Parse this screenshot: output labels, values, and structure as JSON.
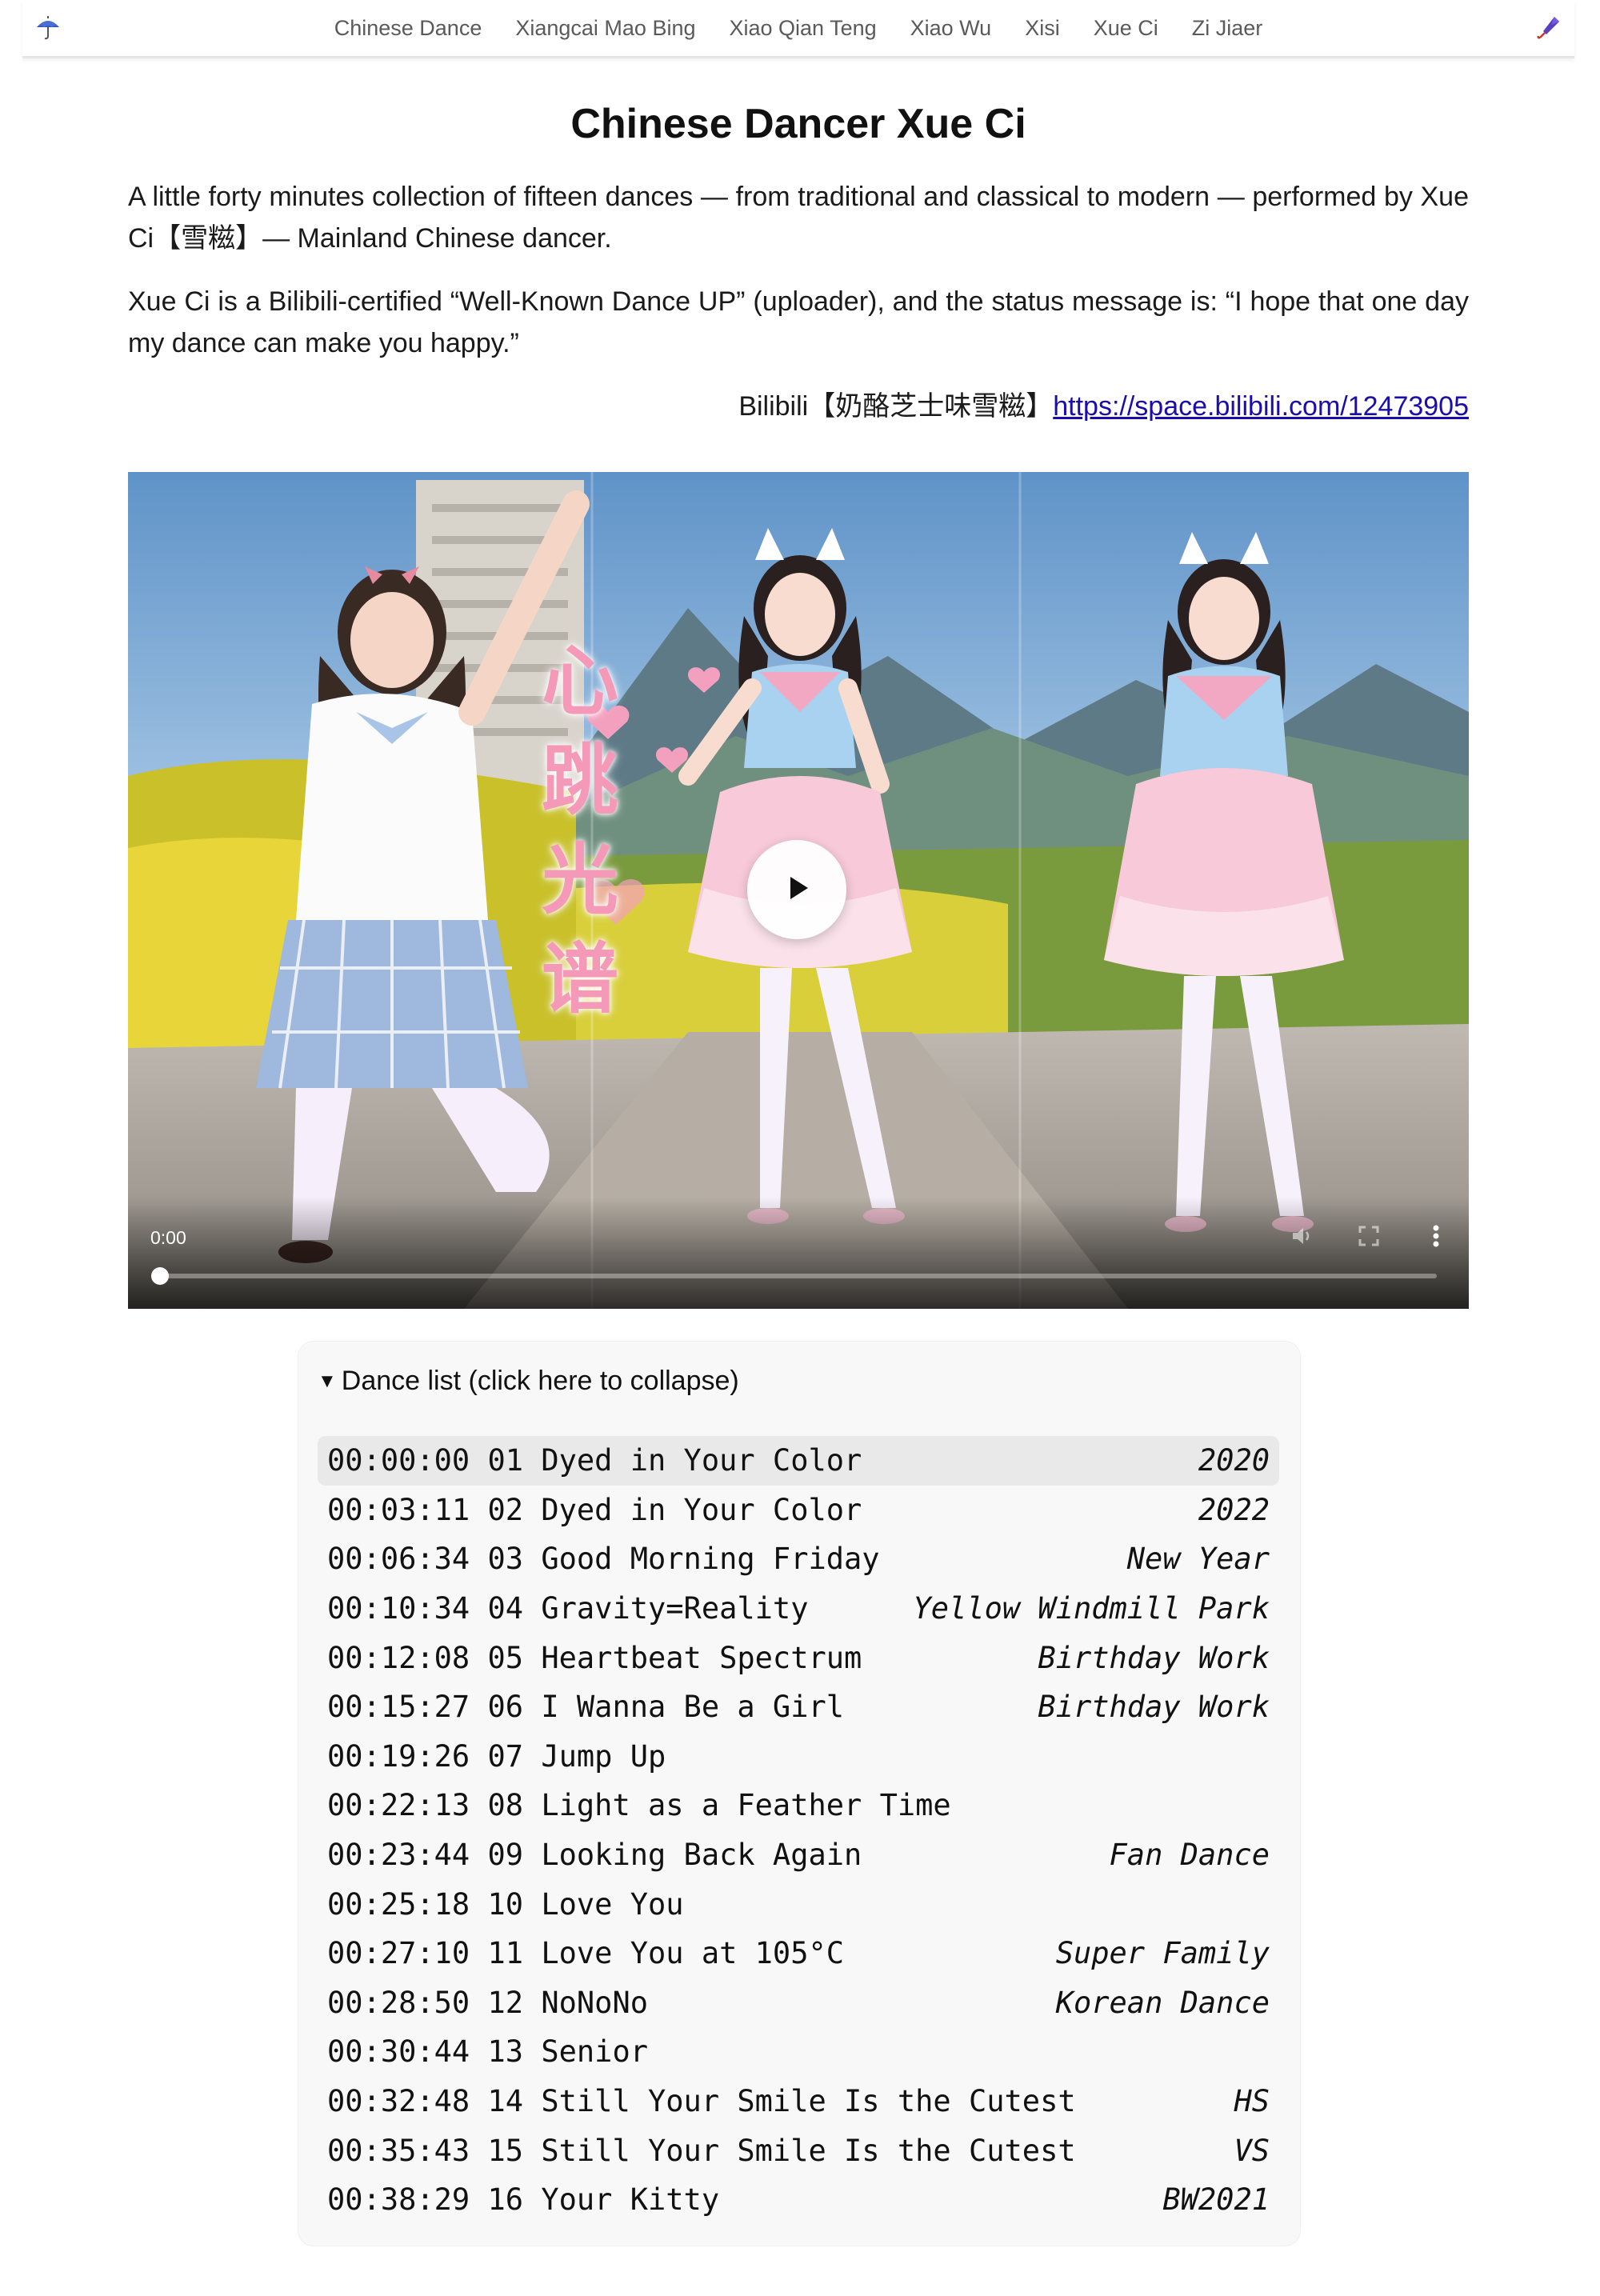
{
  "nav": {
    "left_icon": "umbrella-icon",
    "right_icon": "closed-umbrella-icon",
    "links": [
      "Chinese Dance",
      "Xiangcai Mao Bing",
      "Xiao Qian Teng",
      "Xiao Wu",
      "Xisi",
      "Xue Ci",
      "Zi Jiaer"
    ]
  },
  "page": {
    "title": "Chinese Dancer Xue Ci",
    "intro": "A little forty minutes collection of fifteen dances — from traditional and classical to modern — performed by Xue Ci【雪糍】— Mainland Chinese dancer.",
    "status": "Xue Ci is a Bilibili-certified “Well-Known Dance UP” (uploader), and the status message is: “I hope that one day my dance can make you happy.”",
    "bili_label": "Bilibili【奶酪芝士味雪糍】",
    "bili_link": "https://space.bilibili.com/12473905"
  },
  "video": {
    "poster_text": "心跳光谱",
    "current_time": "0:00",
    "progress": 0,
    "icons": [
      "play-icon",
      "volume-icon",
      "fullscreen-icon",
      "more-options-icon"
    ],
    "colors": {
      "sky": "#6fa0cf",
      "accent_pink": "#f2a7c3"
    }
  },
  "dance_list": {
    "summary": "Dance list (click here to collapse)",
    "expanded": true,
    "items": [
      {
        "time": "00:00:00",
        "num": "01",
        "title": "Dyed in Your Color",
        "tag": "2020",
        "highlight": true
      },
      {
        "time": "00:03:11",
        "num": "02",
        "title": "Dyed in Your Color",
        "tag": "2022"
      },
      {
        "time": "00:06:34",
        "num": "03",
        "title": "Good Morning Friday",
        "tag": "New Year"
      },
      {
        "time": "00:10:34",
        "num": "04",
        "title": "Gravity=Reality",
        "tag": "Yellow Windmill Park"
      },
      {
        "time": "00:12:08",
        "num": "05",
        "title": "Heartbeat Spectrum",
        "tag": "Birthday Work"
      },
      {
        "time": "00:15:27",
        "num": "06",
        "title": "I Wanna Be a Girl",
        "tag": "Birthday Work"
      },
      {
        "time": "00:19:26",
        "num": "07",
        "title": "Jump Up",
        "tag": ""
      },
      {
        "time": "00:22:13",
        "num": "08",
        "title": "Light as a Feather Time",
        "tag": ""
      },
      {
        "time": "00:23:44",
        "num": "09",
        "title": "Looking Back Again",
        "tag": "Fan Dance"
      },
      {
        "time": "00:25:18",
        "num": "10",
        "title": "Love You",
        "tag": ""
      },
      {
        "time": "00:27:10",
        "num": "11",
        "title": "Love You at 105°C",
        "tag": "Super Family"
      },
      {
        "time": "00:28:50",
        "num": "12",
        "title": "NoNoNo",
        "tag": "Korean Dance"
      },
      {
        "time": "00:30:44",
        "num": "13",
        "title": "Senior",
        "tag": ""
      },
      {
        "time": "00:32:48",
        "num": "14",
        "title": "Still Your Smile Is the Cutest",
        "tag": "HS"
      },
      {
        "time": "00:35:43",
        "num": "15",
        "title": "Still Your Smile Is the Cutest",
        "tag": "VS"
      },
      {
        "time": "00:38:29",
        "num": "16",
        "title": "Your Kitty",
        "tag": "BW2021"
      }
    ]
  }
}
